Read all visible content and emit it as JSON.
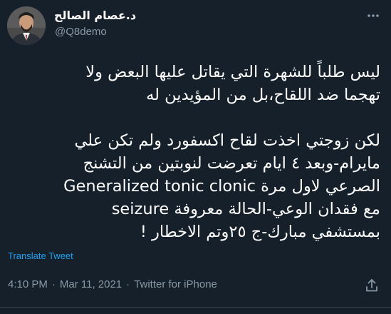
{
  "author": {
    "display_name": "د.عصام الصالح",
    "handle": "@Q8demo",
    "verified": true
  },
  "tweet": {
    "lines": [
      "ليس طلباً للشهرة التي يقاتل عليها   البعض ولا",
      "تهجما ضد اللقاح،بل من المؤيدين له",
      "",
      "لكن زوجتي اخذت لقاح اكسفورد ولم تكن علي",
      "مايرام-وبعد ٤ ايام تعرضت لنوبتين من التشنج",
      "الصرعي لاول مرة Generalized tonic clonic",
      "seizure مع فقدان الوعي-الحالة معروفة",
      "بمستشفي مبارك-ج ٢٥وتم الاخطار !"
    ],
    "translate_label": "Translate Tweet"
  },
  "meta": {
    "time": "4:10 PM",
    "separator": "·",
    "date": "Mar 11, 2021",
    "source": "Twitter for iPhone"
  },
  "icons": {
    "more": "more-dots-icon",
    "verified": "verified-badge-icon",
    "share": "share-icon"
  },
  "colors": {
    "background": "#15202b",
    "text": "#ffffff",
    "muted": "#8899a6",
    "link": "#1da1f2",
    "divider": "#38444d"
  }
}
